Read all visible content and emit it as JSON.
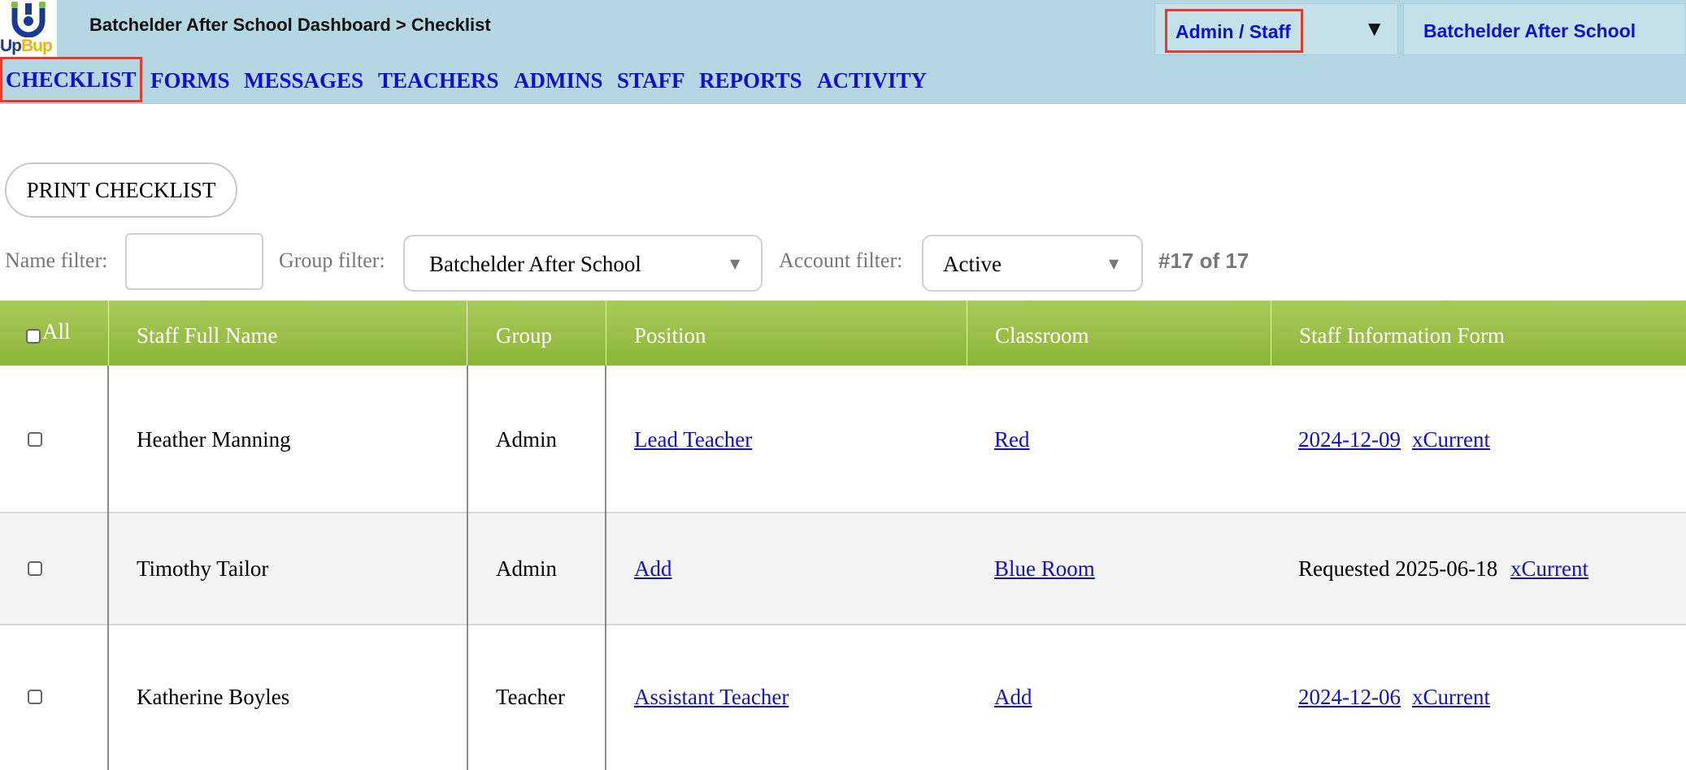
{
  "header": {
    "logo_text_1": "Up",
    "logo_text_2": "Bup",
    "breadcrumb": "Batchelder After School Dashboard > Checklist",
    "role_selector": "Admin / Staff",
    "school_name": "Batchelder After School"
  },
  "nav": {
    "items": [
      "CHECKLIST",
      "FORMS",
      "MESSAGES",
      "TEACHERS",
      "ADMINS",
      "STAFF",
      "REPORTS",
      "ACTIVITY"
    ],
    "active": "CHECKLIST"
  },
  "toolbar": {
    "print_label": "PRINT CHECKLIST",
    "name_filter_label": "Name filter:",
    "name_filter_value": "",
    "group_filter_label": "Group filter:",
    "group_filter_value": "Batchelder After School",
    "account_filter_label": "Account filter:",
    "account_filter_value": "Active",
    "count_text": "#17 of 17"
  },
  "table": {
    "select_all_label": "All",
    "columns": [
      "Staff Full Name",
      "Group",
      "Position",
      "Classroom",
      "Staff Information Form"
    ],
    "rows": [
      {
        "name": "Heather Manning",
        "group": "Admin",
        "position": "Lead Teacher",
        "classroom": "Red",
        "form_date": "2024-12-09",
        "form_action": "xCurrent"
      },
      {
        "name": "Timothy Tailor",
        "group": "Admin",
        "position": "Add",
        "classroom": "Blue Room",
        "form_requested": "Requested 2025-06-18",
        "form_action": "xCurrent"
      },
      {
        "name": "Katherine Boyles",
        "group": "Teacher",
        "position": "Assistant Teacher",
        "classroom": "Add",
        "form_date": "2024-12-06",
        "form_action": "xCurrent"
      }
    ]
  },
  "colors": {
    "header_bg": "#b4d7e3",
    "nav_link": "#1111cc",
    "table_header": "#98be45",
    "highlight_box": "#e53b2c"
  },
  "icons": {
    "logo": "upbup-logo-icon",
    "dropdown": "triangle-down-icon"
  }
}
